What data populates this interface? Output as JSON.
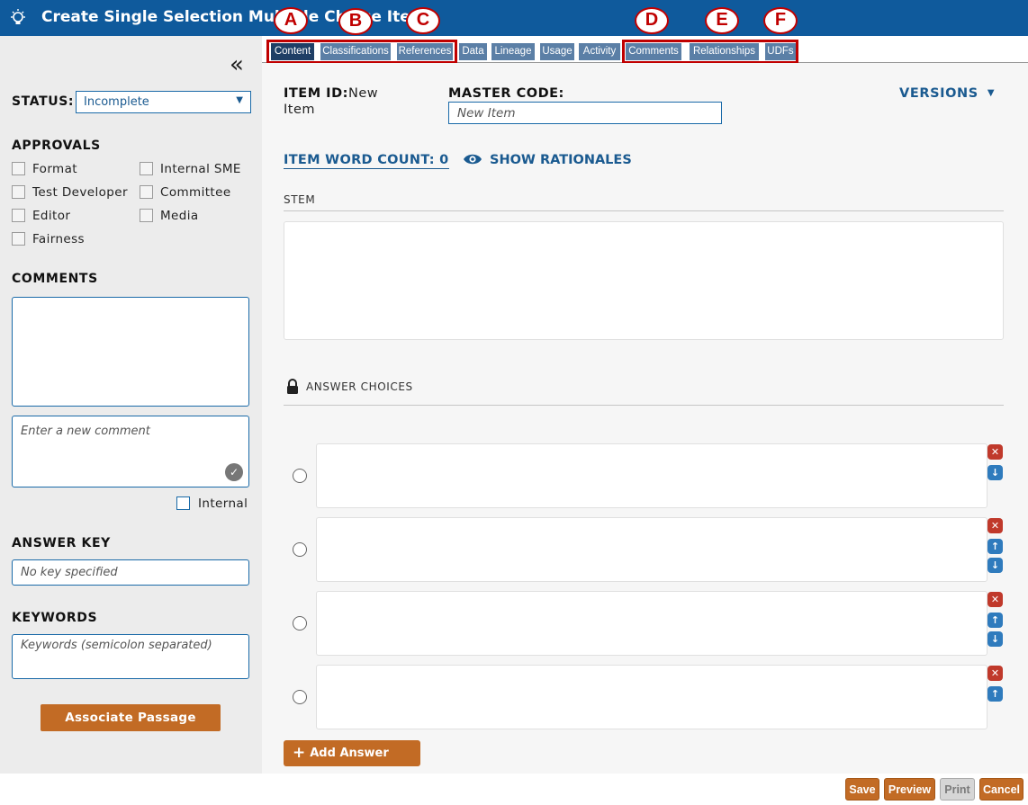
{
  "titlebar": {
    "title": "Create Single Selection Multiple Choice Item",
    "icon": "lightbulb-icon"
  },
  "sidebar": {
    "collapse_glyph": "«",
    "status_label": "STATUS:",
    "status_value": "Incomplete",
    "approvals_label": "APPROVALS",
    "approvals": [
      "Format",
      "Internal SME",
      "Test Developer",
      "Committee",
      "Editor",
      "Media",
      "Fairness"
    ],
    "comments_label": "COMMENTS",
    "new_comment_placeholder": "Enter a new comment",
    "internal_label": "Internal",
    "answer_key_label": "ANSWER KEY",
    "answer_key_placeholder": "No key specified",
    "keywords_label": "KEYWORDS",
    "keywords_placeholder": "Keywords (semicolon separated)",
    "associate_button": "Associate Passage"
  },
  "tabs": [
    {
      "label": "Content",
      "active": true
    },
    {
      "label": "Classifications"
    },
    {
      "label": "References"
    },
    {
      "label": "Data"
    },
    {
      "label": "Lineage"
    },
    {
      "label": "Usage"
    },
    {
      "label": "Activity"
    },
    {
      "label": "Comments"
    },
    {
      "label": "Relationships"
    },
    {
      "label": "UDFs"
    }
  ],
  "callouts": [
    "A",
    "B",
    "C",
    "D",
    "E",
    "F"
  ],
  "main": {
    "item_id_label": "ITEM ID:",
    "item_id_value_1": "New",
    "item_id_value_2": "Item",
    "master_code_label": "MASTER CODE:",
    "master_code_placeholder": "New Item",
    "versions_label": "VERSIONS",
    "word_count_label": "ITEM WORD COUNT: 0",
    "show_rationales_label": "SHOW RATIONALES",
    "stem_label": "STEM",
    "answer_choices_label": "ANSWER CHOICES",
    "add_choice_label": "Add Answer Choice"
  },
  "footer": {
    "save": "Save",
    "preview": "Preview",
    "print": "Print",
    "cancel": "Cancel"
  },
  "colors": {
    "header_blue": "#0f5a9c",
    "tab_blue": "#5b7fa6",
    "accent_orange": "#c26b25",
    "callout_red": "#c00000",
    "link_blue": "#1a5a90"
  }
}
